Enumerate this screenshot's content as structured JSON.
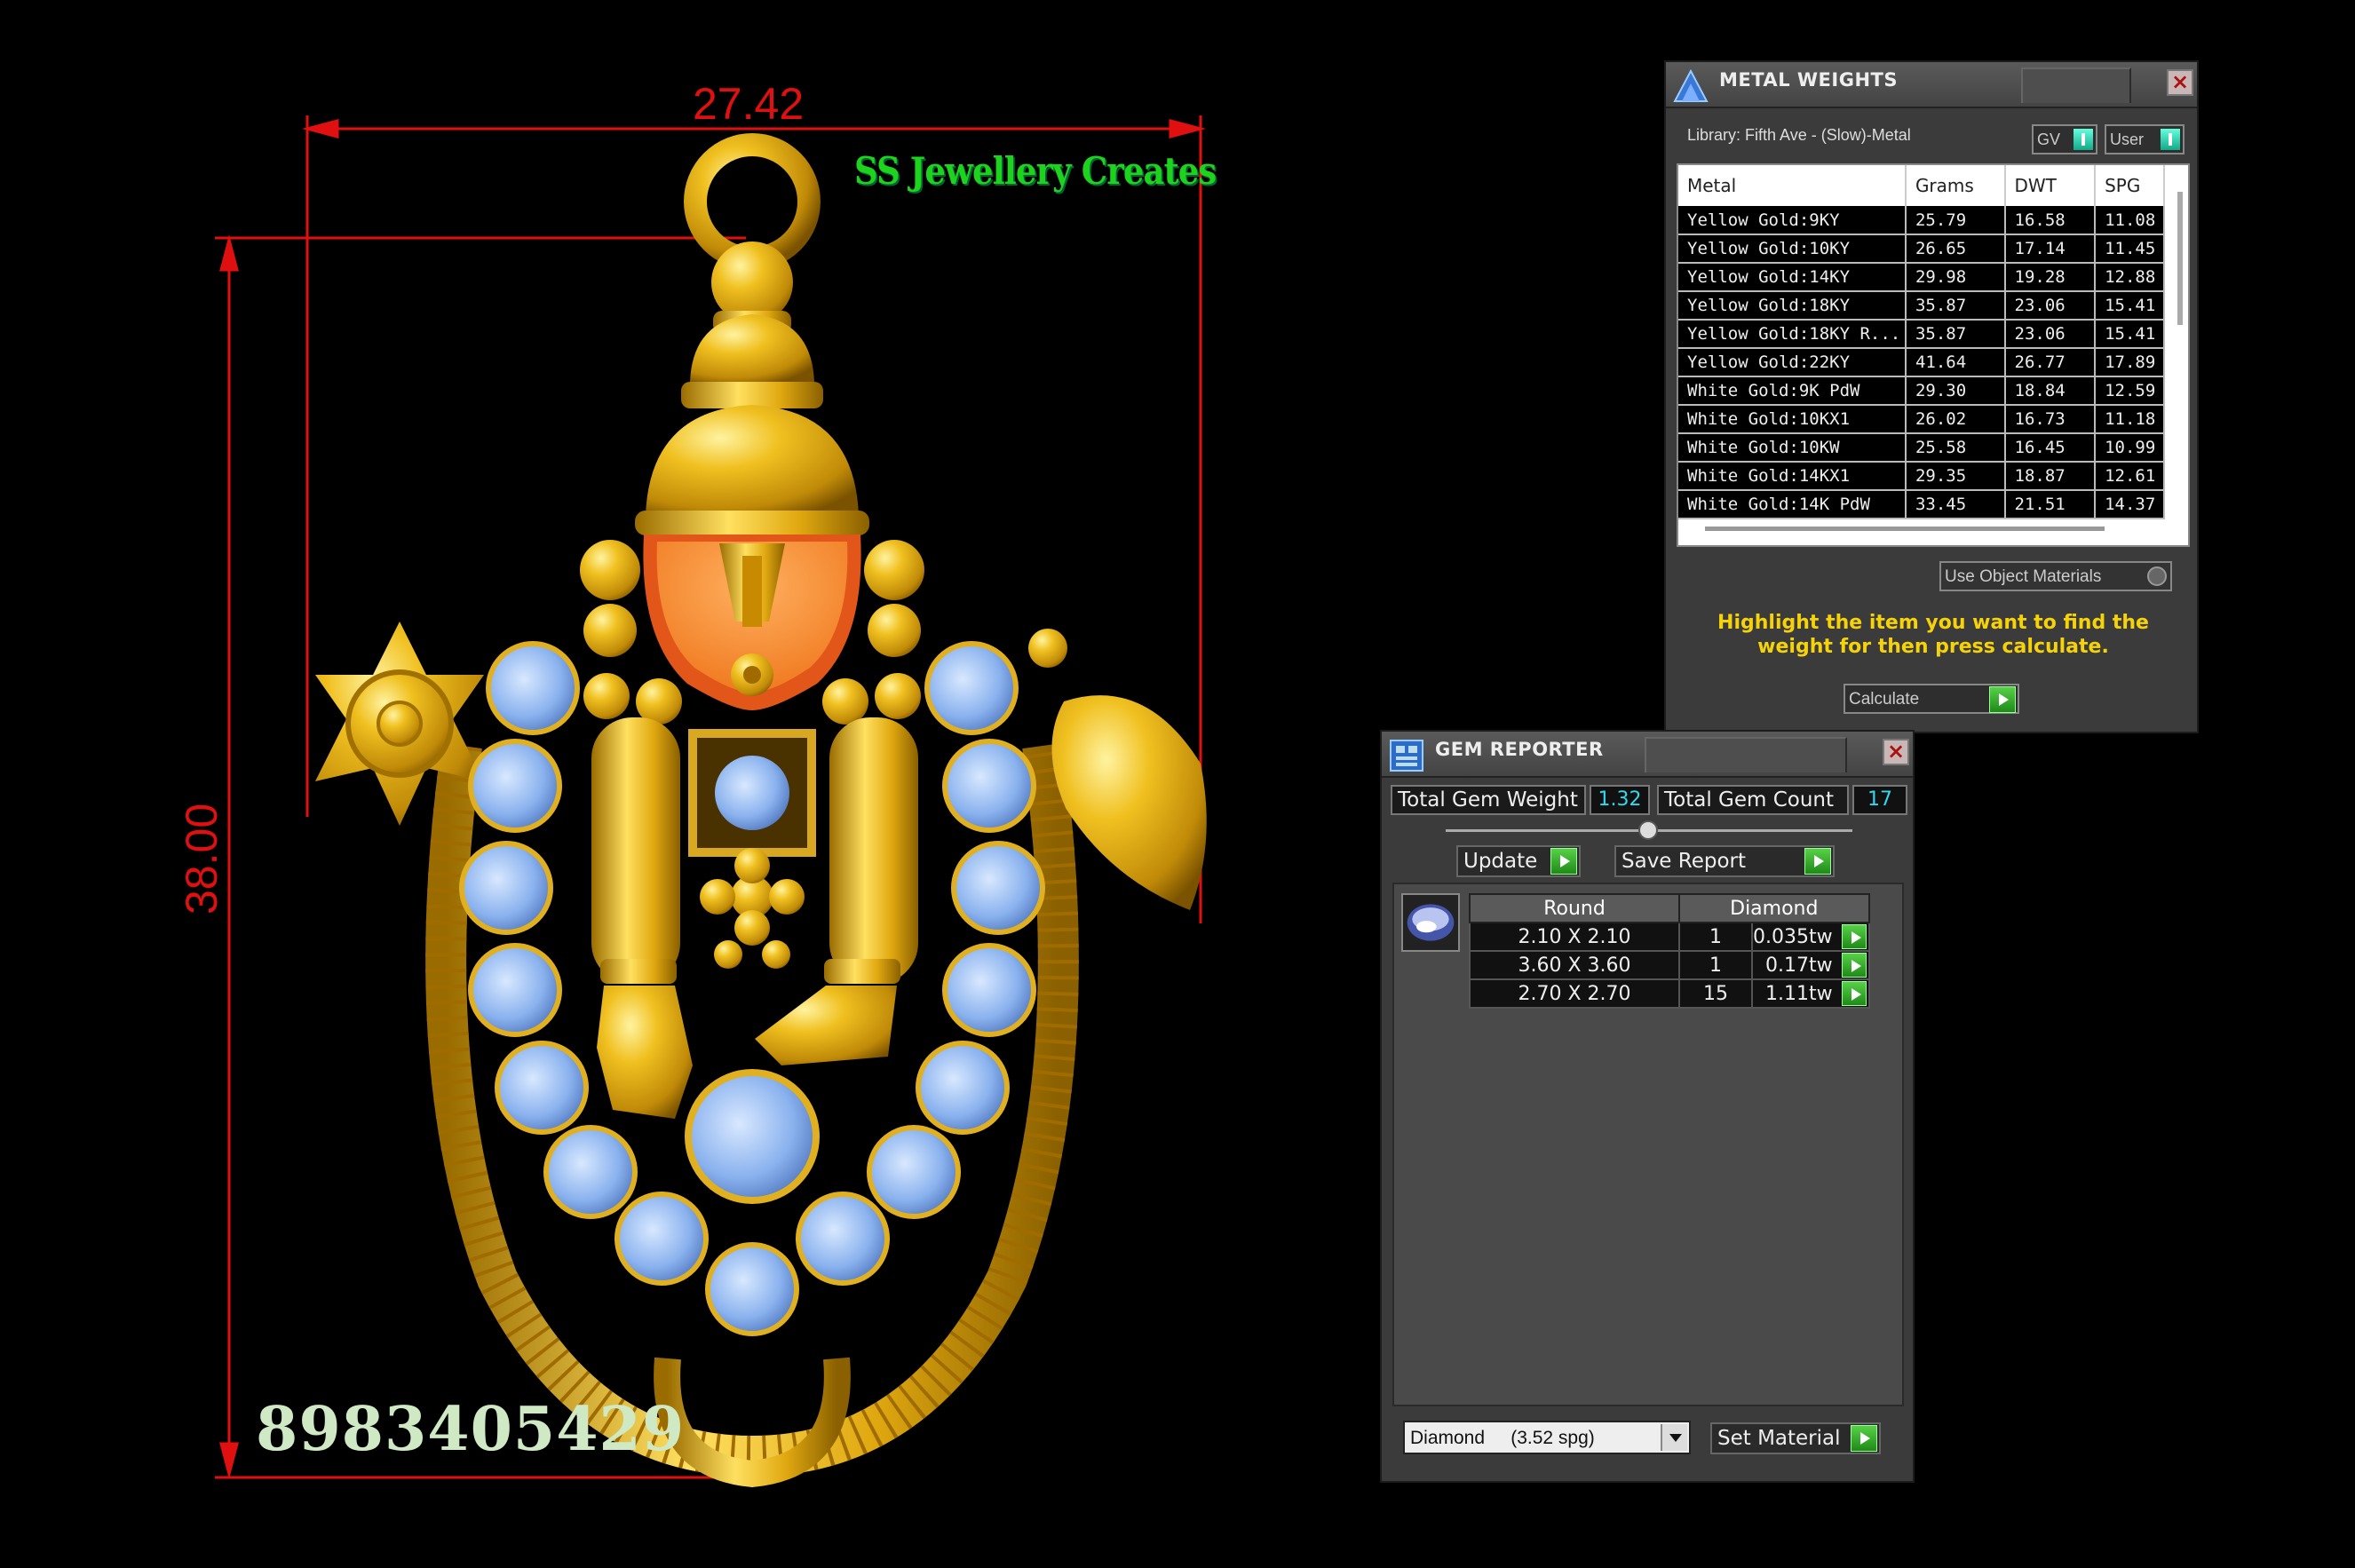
{
  "viewport": {
    "dimension_width": "27.42",
    "dimension_height": "38.00",
    "watermark": "SS Jewellery Creates",
    "phone": "8983405429"
  },
  "metal_weights": {
    "title": "METAL WEIGHTS",
    "close_icon": "close-icon",
    "library": "Library: Fifth Ave - (Slow)-Metal",
    "toggle_gv": "GV",
    "toggle_user": "User",
    "columns": [
      "Metal",
      "Grams",
      "DWT",
      "SPG"
    ],
    "rows": [
      [
        "Yellow Gold:9KY",
        "25.79",
        "16.58",
        "11.08"
      ],
      [
        "Yellow Gold:10KY",
        "26.65",
        "17.14",
        "11.45"
      ],
      [
        "Yellow Gold:14KY",
        "29.98",
        "19.28",
        "12.88"
      ],
      [
        "Yellow Gold:18KY",
        "35.87",
        "23.06",
        "15.41"
      ],
      [
        "Yellow Gold:18KY R...",
        "35.87",
        "23.06",
        "15.41"
      ],
      [
        "Yellow Gold:22KY",
        "41.64",
        "26.77",
        "17.89"
      ],
      [
        "White Gold:9K PdW",
        "29.30",
        "18.84",
        "12.59"
      ],
      [
        "White Gold:10KX1",
        "26.02",
        "16.73",
        "11.18"
      ],
      [
        "White Gold:10KW",
        "25.58",
        "16.45",
        "10.99"
      ],
      [
        "White Gold:14KX1",
        "29.35",
        "18.87",
        "12.61"
      ],
      [
        "White Gold:14K PdW",
        "33.45",
        "21.51",
        "14.37"
      ]
    ],
    "use_object_materials": "Use Object Materials",
    "hint": "Highlight the item you want to find the weight for then press calculate.",
    "calculate": "Calculate",
    "hint_color": "#f5d20a"
  },
  "gem_reporter": {
    "title": "GEM REPORTER",
    "total_gem_weight_label": "Total Gem Weight",
    "total_gem_weight": "1.32",
    "total_gem_count_label": "Total Gem Count",
    "total_gem_count": "17",
    "update": "Update",
    "save_report": "Save Report",
    "table_headers": [
      "Round",
      "Diamond"
    ],
    "rows": [
      [
        "2.10 X 2.10",
        "1",
        "0.035tw"
      ],
      [
        "3.60 X 3.60",
        "1",
        "0.17tw"
      ],
      [
        "2.70 X 2.70",
        "15",
        "1.11tw"
      ]
    ],
    "material": "Diamond     (3.52 spg)",
    "set_material": "Set Material",
    "value_color": "#33d8ee"
  }
}
